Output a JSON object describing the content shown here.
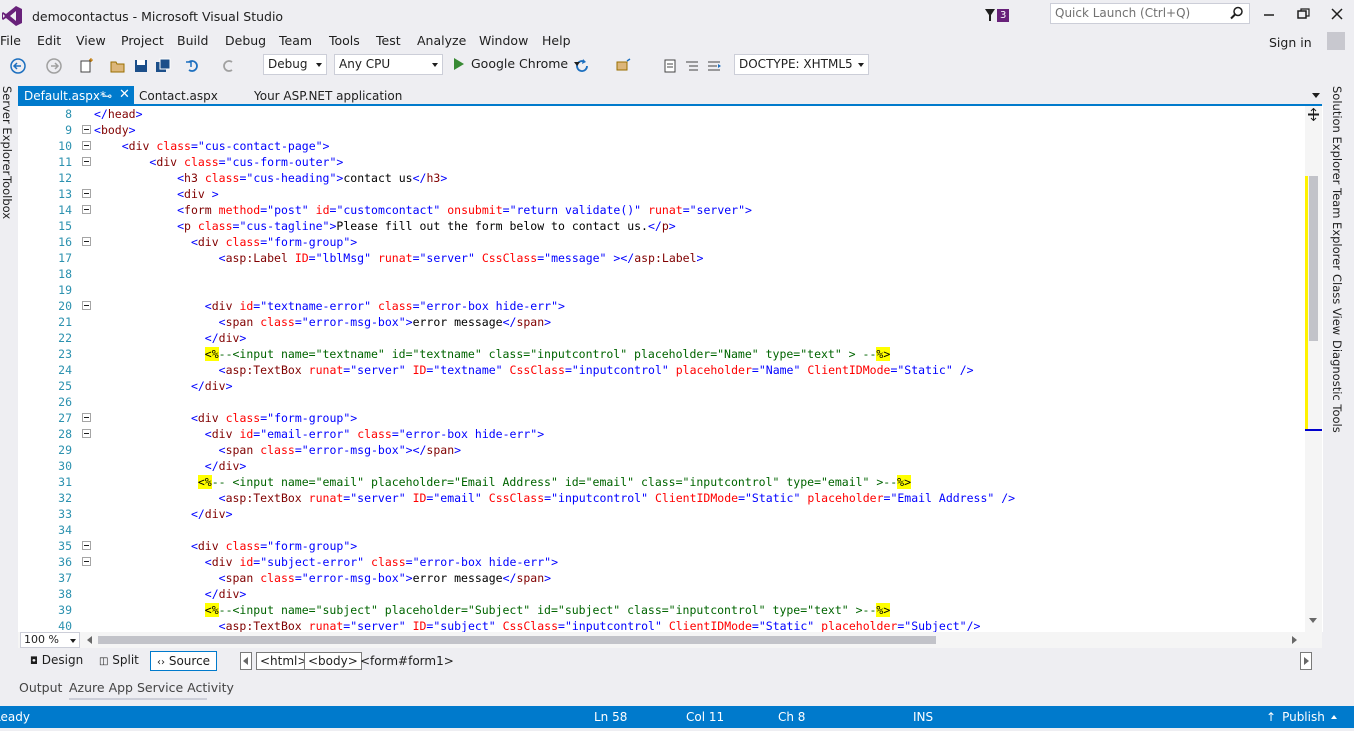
{
  "window": {
    "title": "democontactus - Microsoft Visual Studio",
    "notification_count": "3",
    "quick_launch_placeholder": "Quick Launch (Ctrl+Q)"
  },
  "menu": [
    "File",
    "Edit",
    "View",
    "Project",
    "Build",
    "Debug",
    "Team",
    "Tools",
    "Test",
    "Analyze",
    "Window",
    "Help"
  ],
  "sign_in": "Sign in",
  "toolbar": {
    "config": "Debug",
    "platform": "Any CPU",
    "run_target": "Google Chrome",
    "doctype": "DOCTYPE: XHTML5"
  },
  "left_tools": [
    "Server Explorer",
    "Toolbox"
  ],
  "right_tools": [
    "Solution Explorer",
    "Team Explorer",
    "Class View",
    "Diagnostic Tools"
  ],
  "tabs": [
    {
      "label": "Default.aspx*",
      "active": true
    },
    {
      "label": "Contact.aspx",
      "active": false
    },
    {
      "label": "Your ASP.NET application",
      "active": false
    }
  ],
  "code_lines": [
    {
      "n": "8",
      "text": "</head>"
    },
    {
      "n": "9",
      "text": "<body>"
    },
    {
      "n": "10",
      "text": "    <div class=\"cus-contact-page\">"
    },
    {
      "n": "11",
      "text": "        <div class=\"cus-form-outer\">"
    },
    {
      "n": "12",
      "text": "            <h3 class=\"cus-heading\">contact us</h3>"
    },
    {
      "n": "13",
      "text": "            <div >"
    },
    {
      "n": "14",
      "text": "            <form method=\"post\" id=\"customcontact\" onsubmit=\"return validate()\" runat=\"server\">"
    },
    {
      "n": "15",
      "text": "            <p class=\"cus-tagline\">Please fill out the form below to contact us.</p>"
    },
    {
      "n": "16",
      "text": "              <div class=\"form-group\">"
    },
    {
      "n": "17",
      "text": "                  <asp:Label ID=\"lblMsg\" runat=\"server\" CssClass=\"message\" ></asp:Label>"
    },
    {
      "n": "18",
      "text": ""
    },
    {
      "n": "19",
      "text": ""
    },
    {
      "n": "20",
      "text": "                <div id=\"textname-error\" class=\"error-box hide-err\">"
    },
    {
      "n": "21",
      "text": "                  <span class=\"error-msg-box\">error message</span>"
    },
    {
      "n": "22",
      "text": "                </div>"
    },
    {
      "n": "23",
      "text": "                <%--<input name=\"textname\" id=\"textname\" class=\"inputcontrol\" placeholder=\"Name\" type=\"text\" > --%>"
    },
    {
      "n": "24",
      "text": "                  <asp:TextBox runat=\"server\" ID=\"textname\" CssClass=\"inputcontrol\" placeholder=\"Name\" ClientIDMode=\"Static\" />"
    },
    {
      "n": "25",
      "text": "              </div>"
    },
    {
      "n": "26",
      "text": ""
    },
    {
      "n": "27",
      "text": "              <div class=\"form-group\">"
    },
    {
      "n": "28",
      "text": "                <div id=\"email-error\" class=\"error-box hide-err\">"
    },
    {
      "n": "29",
      "text": "                  <span class=\"error-msg-box\"></span>"
    },
    {
      "n": "30",
      "text": "                </div>"
    },
    {
      "n": "31",
      "text": "               <%-- <input name=\"email\" placeholder=\"Email Address\" id=\"email\" class=\"inputcontrol\" type=\"email\" >--%>"
    },
    {
      "n": "32",
      "text": "                  <asp:TextBox runat=\"server\" ID=\"email\" CssClass=\"inputcontrol\" ClientIDMode=\"Static\" placeholder=\"Email Address\" />"
    },
    {
      "n": "33",
      "text": "              </div>"
    },
    {
      "n": "34",
      "text": ""
    },
    {
      "n": "35",
      "text": "              <div class=\"form-group\">"
    },
    {
      "n": "36",
      "text": "                <div id=\"subject-error\" class=\"error-box hide-err\">"
    },
    {
      "n": "37",
      "text": "                  <span class=\"error-msg-box\">error message</span>"
    },
    {
      "n": "38",
      "text": "                </div>"
    },
    {
      "n": "39",
      "text": "                <%--<input name=\"subject\" placeholder=\"Subject\" id=\"subject\" class=\"inputcontrol\" type=\"text\" >--%>"
    },
    {
      "n": "40",
      "text": "                  <asp:TextBox runat=\"server\" ID=\"subject\" CssClass=\"inputcontrol\" ClientIDMode=\"Static\" placeholder=\"Subject\"/>"
    }
  ],
  "zoom": "100 %",
  "designer": {
    "design": "Design",
    "split": "Split",
    "source": "Source",
    "crumbs": [
      "<html>",
      "<body>",
      "<form#form1>"
    ]
  },
  "output_tabs": [
    "Output",
    "Azure App Service Activity"
  ],
  "status": {
    "ready": "Ready",
    "ln": "Ln 58",
    "col": "Col 11",
    "ch": "Ch 8",
    "ins": "INS",
    "publish": "Publish"
  }
}
